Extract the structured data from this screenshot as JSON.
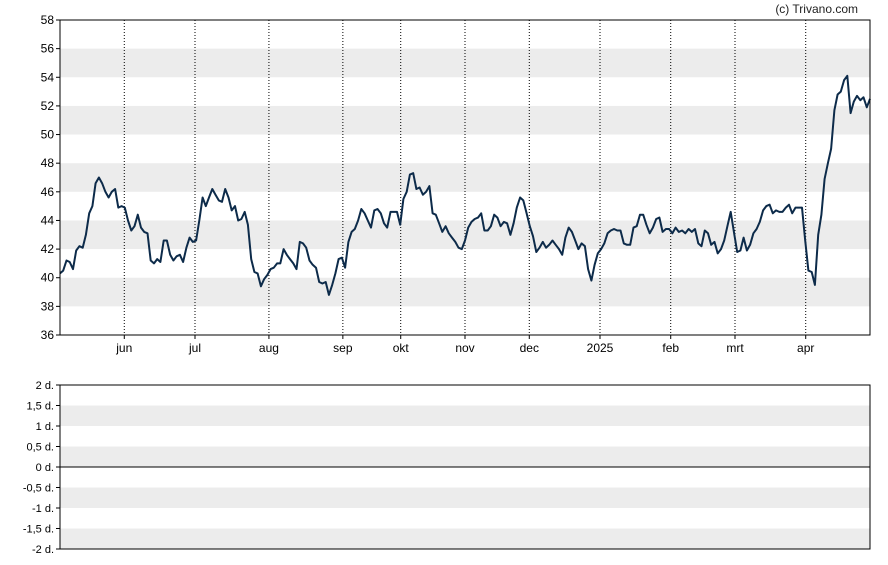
{
  "credit": "(c) Trivano.com",
  "colors": {
    "line": "#0d2b4a",
    "band": "#ececec",
    "grid": "#000000",
    "frame": "#000000",
    "text": "#000000"
  },
  "chart_data": [
    {
      "type": "line",
      "title": "",
      "xlabel": "",
      "ylabel": "",
      "ylim": [
        36,
        58
      ],
      "yticks": [
        "36",
        "38",
        "40",
        "42",
        "44",
        "46",
        "48",
        "50",
        "52",
        "54",
        "56",
        "58"
      ],
      "grid": "horizontal bands every 2 units, dotted vertical lines at month starts",
      "x_ticks": [
        {
          "label": "jun",
          "x": 20
        },
        {
          "label": "jul",
          "x": 42
        },
        {
          "label": "aug",
          "x": 65
        },
        {
          "label": "sep",
          "x": 88
        },
        {
          "label": "okt",
          "x": 106
        },
        {
          "label": "nov",
          "x": 126
        },
        {
          "label": "dec",
          "x": 146
        },
        {
          "label": "2025",
          "x": 168
        },
        {
          "label": "feb",
          "x": 190
        },
        {
          "label": "mrt",
          "x": 210
        },
        {
          "label": "apr",
          "x": 232
        }
      ],
      "x_range": [
        0,
        252
      ],
      "series": [
        {
          "values": [
            40.3,
            40.5,
            41.2,
            41.1,
            40.6,
            41.9,
            42.2,
            42.1,
            43.0,
            44.5,
            45.0,
            46.6,
            47.0,
            46.6,
            46.0,
            45.6,
            46.0,
            46.2,
            44.9,
            45.0,
            44.9,
            44.0,
            43.3,
            43.6,
            44.4,
            43.5,
            43.2,
            43.1,
            41.2,
            41.0,
            41.3,
            41.1,
            42.6,
            42.6,
            41.6,
            41.2,
            41.5,
            41.6,
            41.1,
            42.1,
            42.8,
            42.5,
            42.6,
            44.0,
            45.6,
            45.0,
            45.6,
            46.2,
            45.8,
            45.4,
            45.3,
            46.2,
            45.6,
            44.7,
            45.0,
            44.0,
            44.1,
            44.6,
            43.7,
            41.3,
            40.4,
            40.3,
            39.4,
            39.9,
            40.2,
            40.6,
            40.7,
            41.0,
            41.0,
            42.0,
            41.6,
            41.3,
            41.0,
            40.6,
            42.5,
            42.4,
            42.1,
            41.2,
            40.9,
            40.7,
            39.7,
            39.6,
            39.7,
            38.8,
            39.5,
            40.3,
            41.3,
            41.4,
            40.7,
            42.5,
            43.2,
            43.4,
            44.0,
            44.8,
            44.5,
            44.0,
            43.5,
            44.7,
            44.8,
            44.5,
            43.8,
            43.5,
            44.6,
            44.6,
            44.6,
            43.7,
            45.5,
            46.0,
            47.2,
            47.3,
            46.2,
            46.3,
            45.8,
            46.0,
            46.4,
            44.5,
            44.4,
            43.8,
            43.2,
            43.6,
            43.1,
            42.8,
            42.5,
            42.1,
            42.0,
            42.6,
            43.5,
            43.9,
            44.1,
            44.2,
            44.5,
            43.3,
            43.3,
            43.6,
            44.4,
            44.2,
            43.6,
            43.9,
            43.8,
            43.0,
            43.8,
            44.9,
            45.6,
            45.4,
            44.5,
            43.6,
            42.9,
            41.8,
            42.1,
            42.5,
            42.1,
            42.3,
            42.6,
            42.3,
            42.0,
            41.6,
            42.8,
            43.5,
            43.2,
            42.6,
            42.0,
            42.4,
            42.2,
            40.6,
            39.8,
            40.9,
            41.7,
            42.0,
            42.4,
            43.1,
            43.3,
            43.4,
            43.3,
            43.3,
            42.4,
            42.3,
            42.3,
            43.5,
            43.6,
            44.4,
            44.4,
            43.7,
            43.1,
            43.5,
            44.1,
            44.2,
            43.2,
            43.4,
            43.4,
            43.1,
            43.5,
            43.2,
            43.3,
            43.1,
            43.4,
            43.2,
            43.4,
            42.4,
            42.2,
            43.3,
            43.1,
            42.3,
            42.5,
            41.7,
            42.0,
            42.6,
            43.6,
            44.6,
            43.2,
            41.8,
            41.9,
            42.8,
            41.9,
            42.3,
            43.1,
            43.4,
            43.9,
            44.7,
            45.0,
            45.1,
            44.5,
            44.7,
            44.6,
            44.6,
            44.9,
            45.1,
            44.5,
            44.9,
            44.9,
            44.9,
            42.6,
            40.5,
            40.4,
            39.5,
            43.0,
            44.4,
            46.9,
            48.0,
            49.0,
            51.7,
            52.8,
            53.0,
            53.8,
            54.1,
            51.5,
            52.3,
            52.7,
            52.4,
            52.6,
            51.9,
            52.5
          ]
        }
      ]
    },
    {
      "type": "bar",
      "title": "",
      "xlabel": "",
      "ylabel": "",
      "ylim": [
        -2,
        2
      ],
      "yticks": [
        "2 d.",
        "1,5 d.",
        "1 d.",
        "0,5 d.",
        "0 d.",
        "-0,5 d.",
        "-1 d.",
        "-1,5 d.",
        "-2 d."
      ],
      "grid": "horizontal bands every 0.5 units, solid zero line",
      "series": []
    }
  ]
}
